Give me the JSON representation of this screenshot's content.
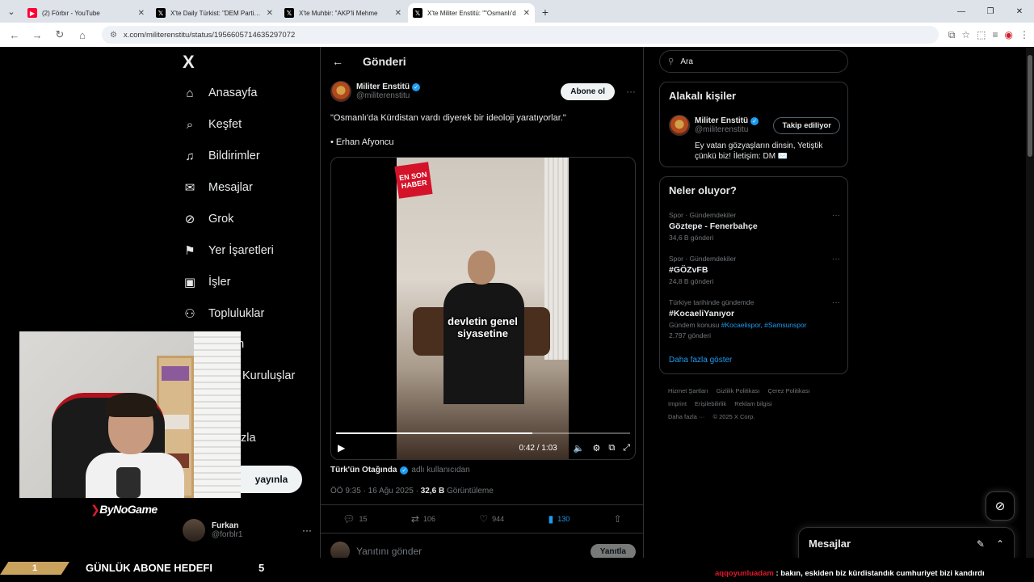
{
  "browser": {
    "tabs": [
      {
        "title": "(2) Förbır - YouTube",
        "icon": "youtube-icon",
        "active": false
      },
      {
        "title": "X'te Daily Türkist: \"DEM Parti Sö",
        "icon": "x-icon",
        "active": false
      },
      {
        "title": "X'te Muhbir: \"AKP'li Mehme",
        "icon": "x-icon",
        "active": false
      },
      {
        "title": "X'te Militer Enstitü: \"\"Osmanlı'd",
        "icon": "x-icon",
        "active": true
      }
    ],
    "url": "x.com/militerenstitu/status/1956605714635297072"
  },
  "nav": {
    "logo": "X",
    "items": [
      {
        "label": "Anasayfa",
        "icon": "home-icon",
        "glyph": "⌂"
      },
      {
        "label": "Keşfet",
        "icon": "search-icon",
        "glyph": "⌕"
      },
      {
        "label": "Bildirimler",
        "icon": "bell-icon",
        "glyph": "🔔"
      },
      {
        "label": "Mesajlar",
        "icon": "mail-icon",
        "glyph": "✉"
      },
      {
        "label": "Grok",
        "icon": "grok-icon",
        "glyph": "⊘"
      },
      {
        "label": "Yer İşaretleri",
        "icon": "bookmark-icon",
        "glyph": "🔖"
      },
      {
        "label": "İşler",
        "icon": "briefcase-icon",
        "glyph": "💼"
      },
      {
        "label": "Topluluklar",
        "icon": "people-icon",
        "glyph": "👥"
      },
      {
        "label": "um",
        "icon": "premium-icon",
        "glyph": ""
      },
      {
        "label": "Kuruluşlar",
        "icon": "org-icon",
        "glyph": ""
      },
      {
        "label": "zla",
        "icon": "more-icon",
        "glyph": ""
      }
    ],
    "post_button": "yayınla",
    "profile": {
      "name": "Furkan",
      "handle": "@forblr1"
    }
  },
  "post": {
    "header_title": "Gönderi",
    "author_name": "Militer Enstitü",
    "author_handle": "@militerenstitu",
    "subscribe_label": "Abone ol",
    "text": "\"Osmanlı'da Kürdistan vardı diyerek bir ideoloji yaratıyorlar.\"",
    "attribution": "• Erhan Afyoncu",
    "video": {
      "badge": "EN SON HABER",
      "caption_line1": "devletin genel",
      "caption_line2": "siyasetine",
      "time": "0:42 / 1:03",
      "progress_fraction": 0.667
    },
    "from_user": "Türk'ün Otağında",
    "from_suffix": "adlı kullanıcıdan",
    "timestamp": "ÖÖ 9:35 · 16 Ağu 2025 · ",
    "views": "32,6 B",
    "views_label": " Görüntüleme",
    "replies": "15",
    "reposts": "106",
    "likes": "944",
    "bookmarks": "130",
    "reply_placeholder": "Yanıtını gönder",
    "reply_button": "Yanıtla"
  },
  "sidebar": {
    "search_placeholder": "Ara",
    "related_title": "Alakalı kişiler",
    "related_user": {
      "name": "Militer Enstitü",
      "handle": "@militerenstitu",
      "follow_label": "Takip ediliyor",
      "bio": "Ey vatan gözyaşların dinsin, Yetiştik çünkü biz! İletişim: DM ✉️"
    },
    "trends_title": "Neler oluyor?",
    "trends": [
      {
        "category": "Spor · Gündemdekiler",
        "name": "Göztepe - Fenerbahçe",
        "count": "34,6 B gönderi"
      },
      {
        "category": "Spor · Gündemdekiler",
        "name": "#GÖZvFB",
        "count": "24,8 B gönderi"
      },
      {
        "category": "Türkiye tarihinde gündemde",
        "name": "#KocaeliYanıyor",
        "topic_prefix": "Gündem konusu ",
        "topic_links": "#Kocaelispor, #Samsunspor",
        "count": "2.797 gönderi"
      }
    ],
    "show_more": "Daha fazla göster",
    "footer": [
      "Hizmet Şartları",
      "Gizlilik Politikası",
      "Çerez Politikası",
      "Imprint",
      "Erişilebilirlik",
      "Reklam bilgisi",
      "Daha fazla ···",
      "© 2025 X Corp."
    ]
  },
  "messages_dock": {
    "title": "Mesajlar"
  },
  "stream": {
    "brand": "ByNoGame",
    "goal_current": "1",
    "goal_label": "GÜNLÜK ABONE HEDEFI",
    "goal_target": "5",
    "chat_user": "aqqoyunluadam",
    "chat_text": " : bakın, eskiden biz kürdistandık cumhuriyet bizi kandırdı"
  }
}
